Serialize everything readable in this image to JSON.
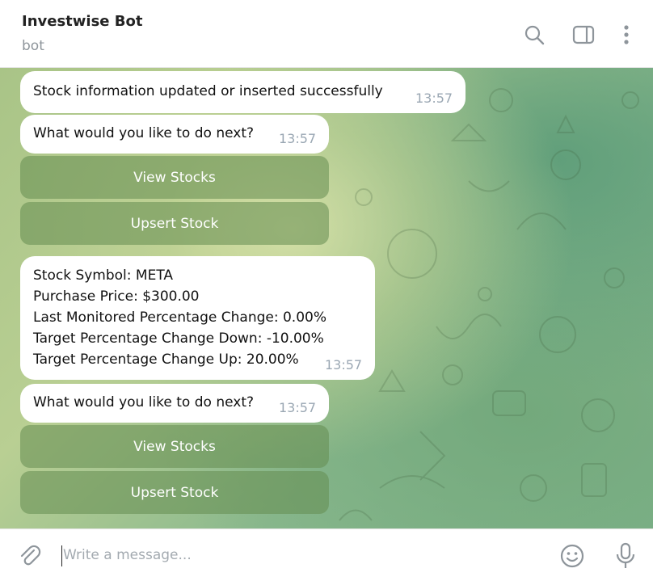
{
  "header": {
    "title": "Investwise Bot",
    "subtitle": "bot"
  },
  "messages": [
    {
      "text": "Stock information updated or inserted successfully",
      "time": "13:57"
    },
    {
      "text": "What would you like to do next?",
      "time": "13:57"
    },
    {
      "text": "Stock Symbol: META\nPurchase Price: $300.00\nLast Monitored Percentage Change: 0.00%\nTarget Percentage Change Down: -10.00%\nTarget Percentage Change Up: 20.00%",
      "time": "13:57"
    },
    {
      "text": "What would you like to do next?",
      "time": "13:57"
    }
  ],
  "keyboard1": {
    "view_label": "View Stocks",
    "upsert_label": "Upsert Stock"
  },
  "keyboard2": {
    "view_label": "View Stocks",
    "upsert_label": "Upsert Stock"
  },
  "composer": {
    "placeholder": "Write a message..."
  },
  "icons": {
    "search": "search-icon",
    "sidebar": "sidebar-toggle-icon",
    "more": "more-vertical-icon",
    "attach": "paperclip-icon",
    "emoji": "emoji-icon",
    "mic": "microphone-icon"
  },
  "colors": {
    "accent_keyboard": "#6c8c5a",
    "timestamp": "#9aa7b3",
    "chat_background": "#a9c487"
  }
}
